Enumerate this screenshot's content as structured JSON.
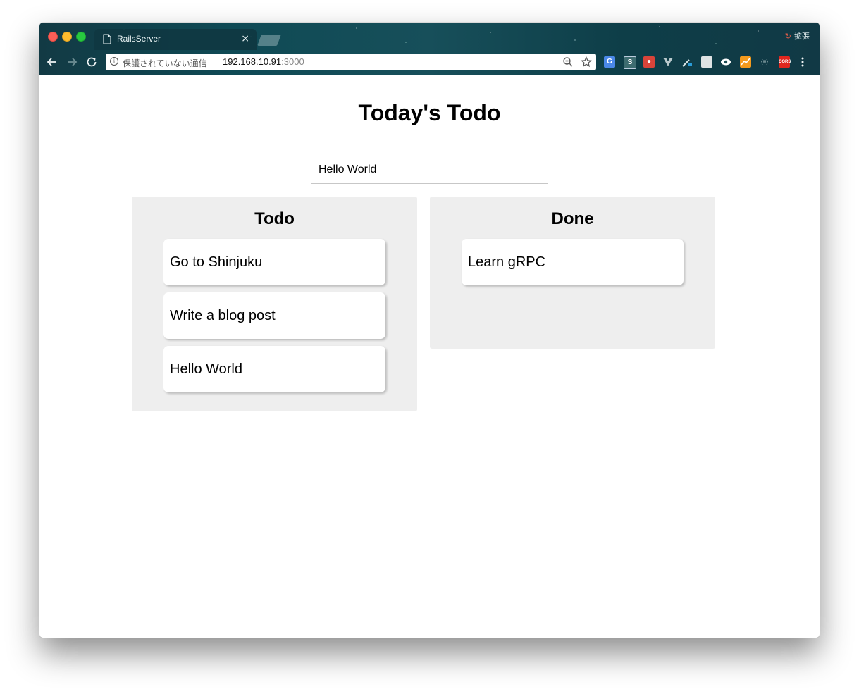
{
  "browser": {
    "tab_title": "RailsServer",
    "tab_close": "×",
    "extension_label": "拡張",
    "security_text": "保護されていない通信",
    "url_host": "192.168.10.91",
    "url_port": ":3000"
  },
  "extensions": [
    "google-translate-icon",
    "s-extension-icon",
    "ladybug-extension-icon",
    "vue-devtools-icon",
    "eyedropper-icon",
    "notes-icon",
    "eye-icon",
    "analytics-icon",
    "json-icon",
    "cors-icon"
  ],
  "extension_text": {
    "cors": "CORS",
    "s": "S",
    "json": "{≡}"
  },
  "app": {
    "title": "Today's Todo",
    "input_value": "Hello World",
    "columns": [
      {
        "title": "Todo",
        "items": [
          "Go to Shinjuku",
          "Write a blog post",
          "Hello World"
        ]
      },
      {
        "title": "Done",
        "items": [
          "Learn gRPC"
        ]
      }
    ]
  }
}
